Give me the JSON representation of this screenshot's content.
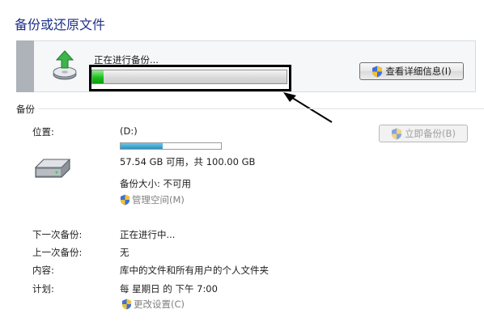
{
  "title": "备份或还原文件",
  "progress": {
    "label": "正在进行备份...",
    "fraction": 0.06
  },
  "buttons": {
    "details": "查看详细信息(I)",
    "backup_now": "立即备份(B)"
  },
  "section": {
    "label": "备份"
  },
  "location": {
    "label": "位置:",
    "drive": "(D:)",
    "used_fraction": 0.42,
    "free_text": "57.54 GB 可用，共 100.00 GB",
    "size_text": "备份大小: 不可用",
    "manage_link": "管理空间(M)"
  },
  "schedule": {
    "next_label": "下一次备份:",
    "next_value": "正在进行中...",
    "last_label": "上一次备份:",
    "last_value": "无",
    "content_label": "内容:",
    "content_value": "库中的文件和所有用户的个人文件夹",
    "plan_label": "计划:",
    "plan_value": "每 星期日 的 下午 7:00",
    "change_link": "更改设置(C)"
  },
  "colors": {
    "title": "#1e3287",
    "progress_green": "#1fbf1f",
    "usage_blue": "#2a8fc0",
    "link_gray": "#808080"
  },
  "icons": [
    "backup-icon",
    "shield-icon",
    "disk-drive-icon",
    "annotation-arrow-icon"
  ]
}
